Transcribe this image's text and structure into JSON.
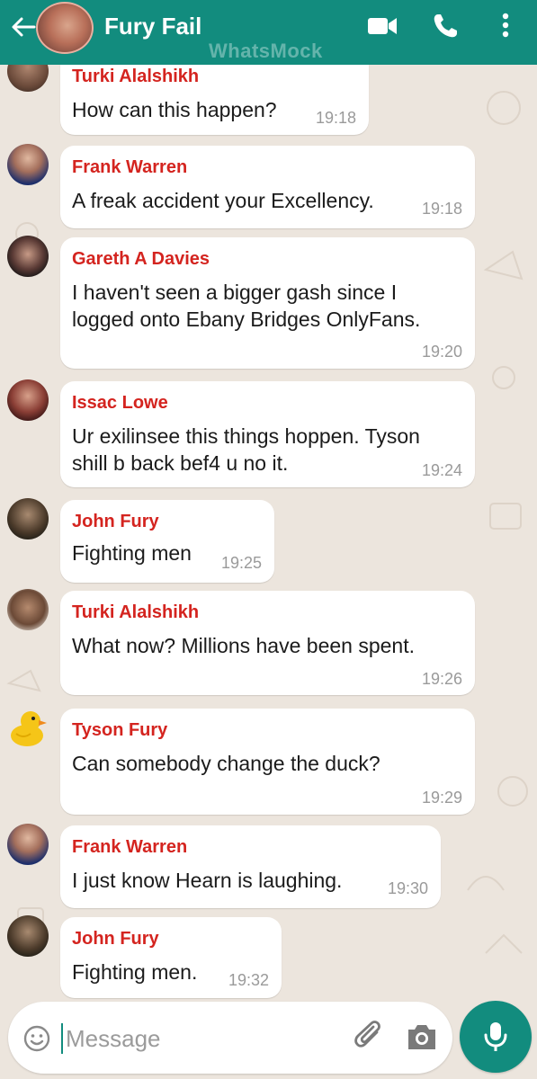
{
  "header": {
    "title": "Fury Fail",
    "watermark": "WhatsMock"
  },
  "messages": [
    {
      "sender": "Turki Alalshikh",
      "text": "How can this happen?",
      "time": "19:18"
    },
    {
      "sender": "Frank Warren",
      "text": "A freak accident your Excellency.",
      "time": "19:18"
    },
    {
      "sender": "Gareth A Davies",
      "text": "I haven't seen a bigger gash since I\nlogged onto Ebany Bridges OnlyFans.",
      "time": "19:20"
    },
    {
      "sender": "Issac Lowe",
      "text": "Ur exilinsee this things hoppen. Tyson\nshill b back bef4 u no it.",
      "time": "19:24"
    },
    {
      "sender": "John Fury",
      "text": "Fighting men",
      "time": "19:25"
    },
    {
      "sender": "Turki Alalshikh",
      "text": "What now? Millions have been spent.",
      "time": "19:26"
    },
    {
      "sender": "Tyson Fury",
      "text": "Can somebody change the duck?",
      "time": "19:29"
    },
    {
      "sender": "Frank Warren",
      "text": "I just know Hearn is laughing.",
      "time": "19:30"
    },
    {
      "sender": "John Fury",
      "text": "Fighting men.",
      "time": "19:32"
    }
  ],
  "composer": {
    "placeholder": "Message"
  },
  "colors": {
    "header_bg": "#128c7e",
    "sender_name": "#d4241f",
    "chat_bg": "#ece5dd"
  },
  "icons": [
    "back-arrow-icon",
    "video-call-icon",
    "phone-icon",
    "more-vertical-icon",
    "emoji-icon",
    "attach-icon",
    "camera-icon",
    "mic-icon"
  ]
}
